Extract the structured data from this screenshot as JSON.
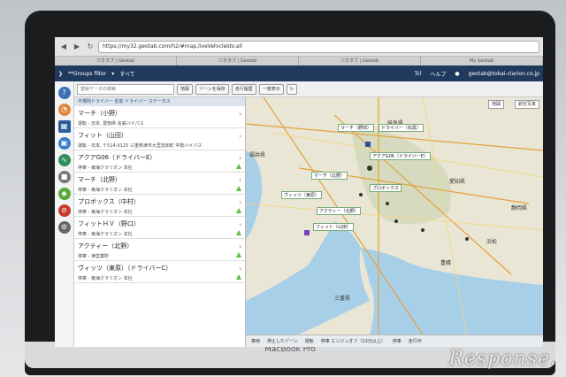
{
  "browser": {
    "url": "https://my32.geotab.com/h2/#map,liveVehicleIds:all",
    "tabs": [
      "ジオタブ | Geotab",
      "ジオタブ | Geotab",
      "ジオタブ | Geotab",
      "My Geotab"
    ]
  },
  "header": {
    "groups_filter": "**Groups filter",
    "all_label": "すべて",
    "pane_label": "ヘルプ",
    "account": "geotab@tokai-clarion.co.jp",
    "db_label": "Tcl"
  },
  "toolbar": {
    "search_placeholder": "登録データの検索",
    "map_button": "地図",
    "save_zone_button": "ゾーンを保存",
    "history_button": "走行履歴",
    "one_click_button": "一度表示"
  },
  "list": {
    "header": "不規則ドライバー 名前 ドライバー ステータス",
    "items": [
      {
        "title": "マーチ（小野）",
        "sub": "運転 - 日本, 愛知県 名鉄バイパス",
        "tri": false
      },
      {
        "title": "フィット（山田）",
        "sub": "運転 - 日本, 〒514-0125 三重県津市大里窪田町 中勢バイパス",
        "tri": false
      },
      {
        "title": "アクアG06（ドライバーE）",
        "sub": "停車 - 東海クラリオン 本社",
        "tri": true
      },
      {
        "title": "マーチ（北野）",
        "sub": "停車 - 東海クラリオン 本社",
        "tri": true
      },
      {
        "title": "プロボックス（中村）",
        "sub": "停車 - 東海クラリオン 本社",
        "tri": true
      },
      {
        "title": "フィットＨＶ（野口）",
        "sub": "停車 - 東海クラリオン 本社",
        "tri": true
      },
      {
        "title": "アクティー（北野）",
        "sub": "停車 - 津営業所",
        "tri": true
      },
      {
        "title": "ヴィッツ（東原）（ドライバーC）",
        "sub": "停車 - 東海クラリオン 本社",
        "tri": true
      }
    ]
  },
  "map": {
    "map_mode_button": "地図",
    "satellite_button": "航空写真",
    "places": [
      "福井県",
      "岐阜県",
      "愛知県",
      "静岡県",
      "豊橋",
      "浜松",
      "三重県"
    ],
    "vehicle_labels": [
      "マーチ（野田）",
      "ドライバー（石黒）",
      "アクアG06（ドライバーE）",
      "マーチ（北野）",
      "プロボックス",
      "フィット（山田）",
      "アクティー（北野）",
      "ヴィッツ（東原）"
    ]
  },
  "legend": {
    "items": [
      "車両",
      "停止したゾーン",
      "運転",
      "停車 エンジンオフ（13分以上）",
      "停車",
      "走行中"
    ]
  },
  "device": {
    "brand": "MacBook Pro",
    "watermark": "Response."
  }
}
